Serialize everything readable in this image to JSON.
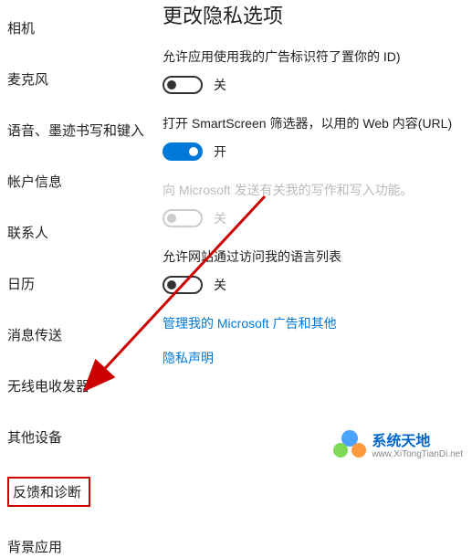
{
  "sidebar": {
    "items": [
      {
        "label": "相机"
      },
      {
        "label": "麦克风"
      },
      {
        "label": "语音、墨迹书写和键入"
      },
      {
        "label": "帐户信息"
      },
      {
        "label": "联系人"
      },
      {
        "label": "日历"
      },
      {
        "label": "消息传送"
      },
      {
        "label": "无线电收发器"
      },
      {
        "label": "其他设备"
      },
      {
        "label": "反馈和诊断"
      },
      {
        "label": "背景应用"
      }
    ]
  },
  "content": {
    "title": "更改隐私选项",
    "settings": [
      {
        "label": "允许应用使用我的广告标识符了置你的 ID)",
        "state": "off",
        "state_text": "关"
      },
      {
        "label": "打开 SmartScreen 筛选器，以用的 Web 内容(URL)",
        "state": "on",
        "state_text": "开"
      },
      {
        "label": "向 Microsoft 发送有关我的写作和写入功能。",
        "state": "disabled",
        "state_text": "关"
      },
      {
        "label": "允许网站通过访问我的语言列表",
        "state": "off",
        "state_text": "关"
      }
    ],
    "links": [
      {
        "text": "管理我的 Microsoft 广告和其他"
      },
      {
        "text": "隐私声明"
      }
    ]
  },
  "watermark": {
    "title": "系统天地",
    "url": "www.XiTongTianDi.net"
  }
}
